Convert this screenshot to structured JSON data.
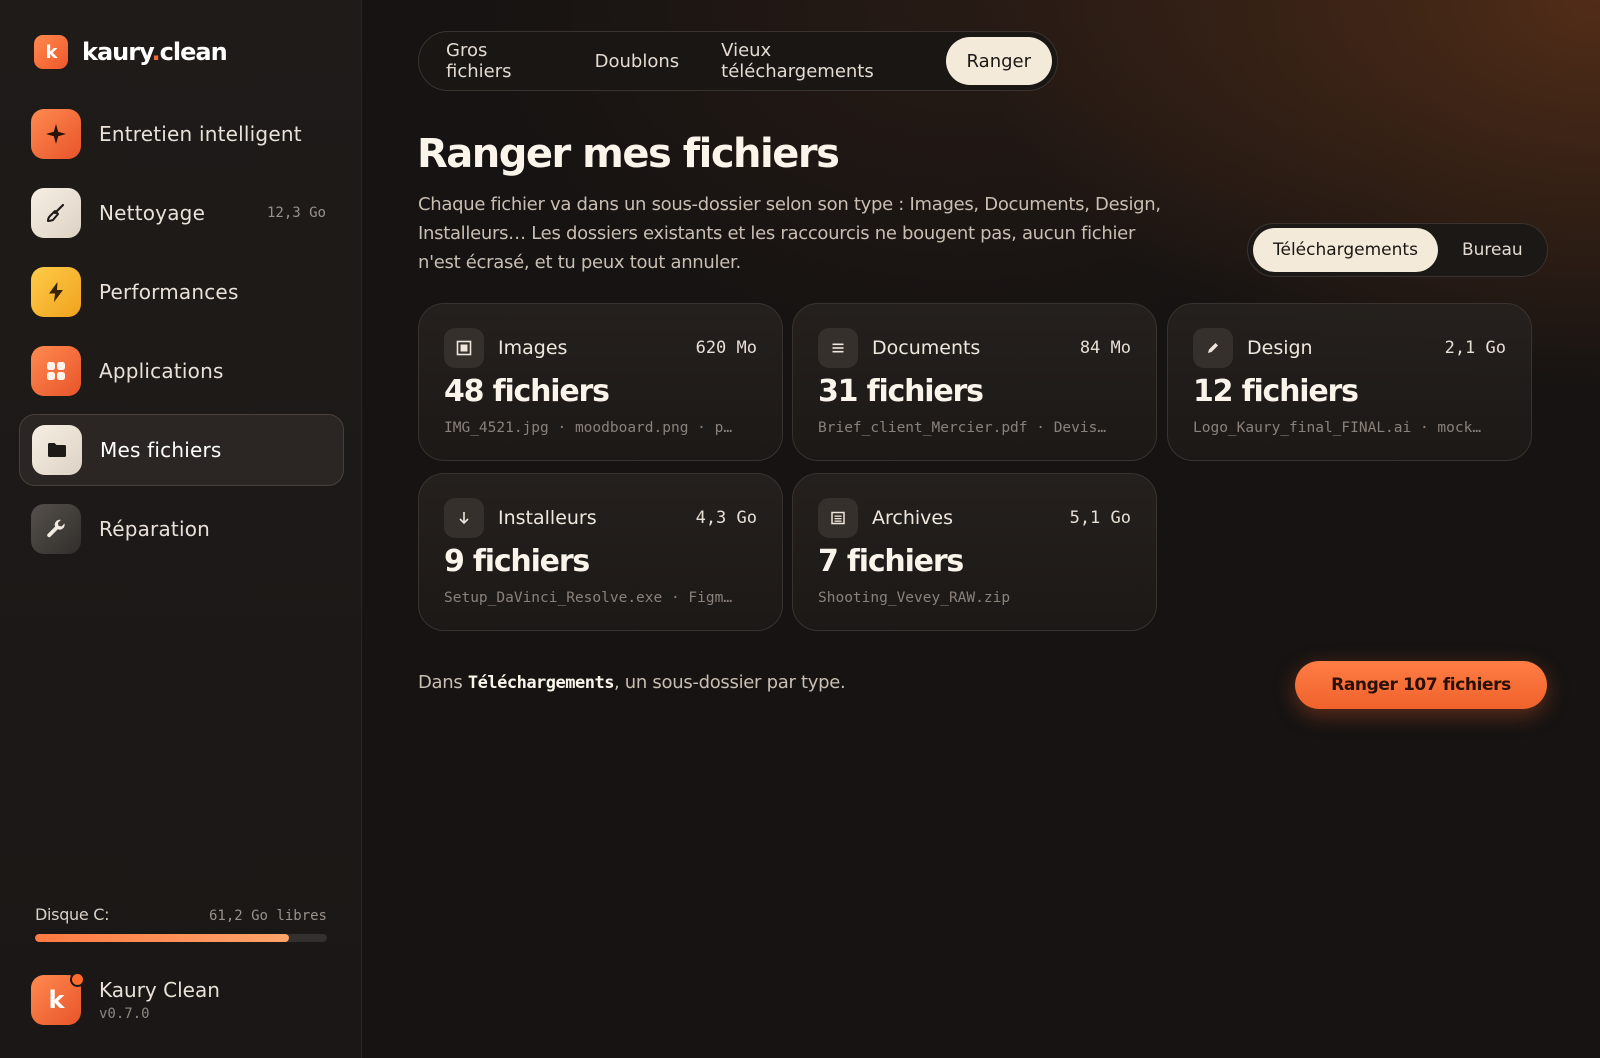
{
  "brand": {
    "mark": "k",
    "name_left": "kaury",
    "name_dot": ".",
    "name_right": "clean"
  },
  "sidebar": {
    "items": [
      {
        "label": "Entretien intelligent",
        "icon": "sparkle-icon",
        "meta": ""
      },
      {
        "label": "Nettoyage",
        "icon": "broom-icon",
        "meta": "12,3 Go"
      },
      {
        "label": "Performances",
        "icon": "lightning-icon",
        "meta": ""
      },
      {
        "label": "Applications",
        "icon": "grid-icon",
        "meta": ""
      },
      {
        "label": "Mes fichiers",
        "icon": "folder-icon",
        "meta": "",
        "active": true
      },
      {
        "label": "Réparation",
        "icon": "wrench-icon",
        "meta": ""
      }
    ],
    "disk": {
      "label": "Disque C:",
      "free": "61,2 Go libres",
      "used_fraction": 0.87
    },
    "app": {
      "name": "Kaury Clean",
      "version": "v0.7.0"
    }
  },
  "tabs": [
    {
      "label": "Gros fichiers",
      "active": false
    },
    {
      "label": "Doublons",
      "active": false
    },
    {
      "label": "Vieux téléchargements",
      "active": false
    },
    {
      "label": "Ranger",
      "active": true
    }
  ],
  "page": {
    "title": "Ranger mes fichiers",
    "description": "Chaque fichier va dans un sous-dossier selon son type : Images, Documents, Design, Installeurs… Les dossiers existants et les raccourcis ne bougent pas, aucun fichier n'est écrasé, et tu peux tout annuler."
  },
  "location_toggle": {
    "options": [
      "Téléchargements",
      "Bureau"
    ],
    "selected": "Téléchargements"
  },
  "categories": [
    {
      "name": "Images",
      "icon": "image-icon",
      "size": "620 Mo",
      "count": "48 fichiers",
      "files": "IMG_4521.jpg · moodboard.png · p…"
    },
    {
      "name": "Documents",
      "icon": "document-icon",
      "size": "84 Mo",
      "count": "31 fichiers",
      "files": "Brief_client_Mercier.pdf · Devis…"
    },
    {
      "name": "Design",
      "icon": "pencil-icon",
      "size": "2,1 Go",
      "count": "12 fichiers",
      "files": "Logo_Kaury_final_FINAL.ai · mock…"
    },
    {
      "name": "Installeurs",
      "icon": "download-arrow-icon",
      "size": "4,3 Go",
      "count": "9 fichiers",
      "files": "Setup_DaVinci_Resolve.exe · Figm…"
    },
    {
      "name": "Archives",
      "icon": "archive-icon",
      "size": "5,1 Go",
      "count": "7 fichiers",
      "files": "Shooting_Vevey_RAW.zip"
    }
  ],
  "footer": {
    "note_prefix": "Dans ",
    "note_folder": "Téléchargements",
    "note_suffix": ", un sous-dossier par type.",
    "action_label": "Ranger 107 fichiers"
  },
  "colors": {
    "accent": "#f0622c",
    "cream": "#f4ead9",
    "background": "#161312"
  }
}
